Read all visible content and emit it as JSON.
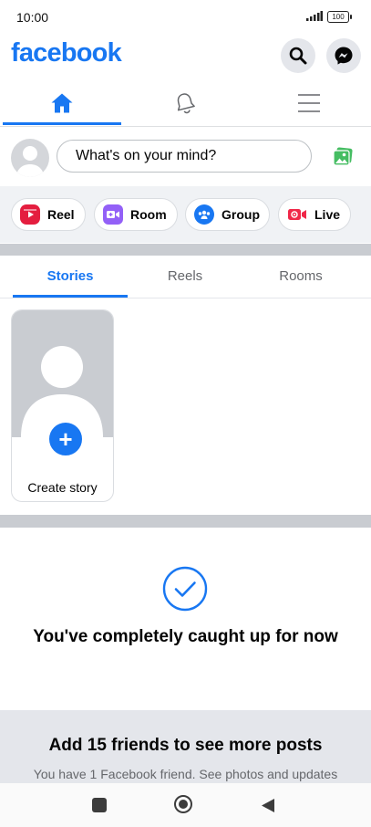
{
  "status_bar": {
    "time": "10:00",
    "battery": "100"
  },
  "header": {
    "logo": "facebook",
    "search_icon": "search-icon",
    "messenger_icon": "messenger-icon"
  },
  "nav": {
    "items": [
      "home-icon",
      "notifications-bell-icon",
      "menu-icon"
    ],
    "active": 0
  },
  "composer": {
    "placeholder": "What's on your mind?"
  },
  "quick_actions": [
    {
      "label": "Reel",
      "icon": "reel-icon",
      "color": "#e41e3f"
    },
    {
      "label": "Room",
      "icon": "room-video-icon",
      "color": "#9360f7"
    },
    {
      "label": "Group",
      "icon": "group-icon",
      "color": "#1877f2"
    },
    {
      "label": "Live",
      "icon": "live-icon",
      "color": "#f02849"
    }
  ],
  "content_tabs": [
    {
      "label": "Stories",
      "active": true
    },
    {
      "label": "Reels",
      "active": false
    },
    {
      "label": "Rooms",
      "active": false
    }
  ],
  "story_card": {
    "label": "Create story"
  },
  "caught_up": {
    "text": "You've completely caught up for now"
  },
  "friends_prompt": {
    "title": "Add 15 friends to see more posts",
    "subtitle": "You have 1 Facebook friend. See photos and updates"
  },
  "colors": {
    "brand": "#1877f2",
    "photo_green": "#45bd62"
  }
}
